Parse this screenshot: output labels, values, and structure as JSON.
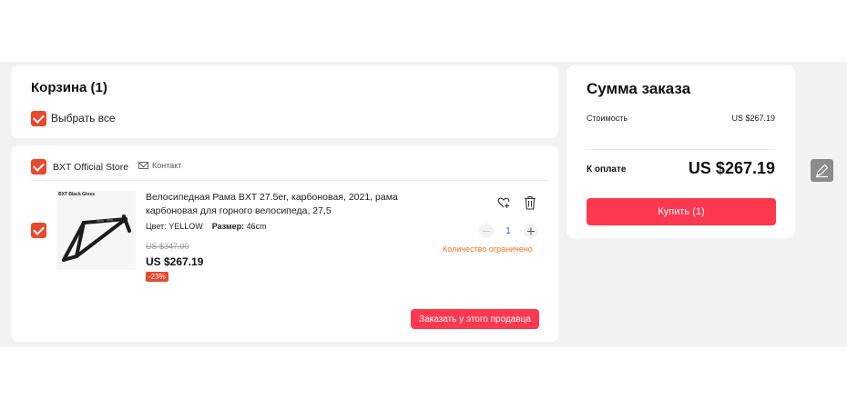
{
  "cart": {
    "title": "Корзина (1)",
    "select_all_label": "Выбрать все"
  },
  "store": {
    "name": "BXT Official Store",
    "contact_label": "Контакт",
    "order_from_seller_label": "Заказать у этого продавца"
  },
  "product": {
    "image_caption": "BXT Black Gloss",
    "title": "Велосипедная Рама BXT 27.5er, карбоновая, 2021, рама карбоновая для горного велосипеда, 27,5",
    "color_key": "Цвет:",
    "color_value": "YELLOW",
    "size_key": "Размер:",
    "size_value": "46cm",
    "old_price": "US $347.00",
    "price": "US $267.19",
    "discount": "-23%",
    "quantity": "1",
    "limited_note": "Количество ограничено"
  },
  "summary": {
    "title": "Сумма заказа",
    "cost_label": "Стоимость",
    "cost_value": "US $267.19",
    "pay_label": "К оплате",
    "pay_value": "US $267.19",
    "buy_label": "Купить (1)"
  },
  "icons": {
    "wishlist": "heart-plus-icon",
    "delete": "trash-icon",
    "mail": "mail-icon",
    "edit": "pencil-icon"
  },
  "colors": {
    "checkbox": "#e8492d",
    "primary_button": "#fd384f",
    "warning_text": "#f57224",
    "quantity_text": "#1a6fd6"
  }
}
